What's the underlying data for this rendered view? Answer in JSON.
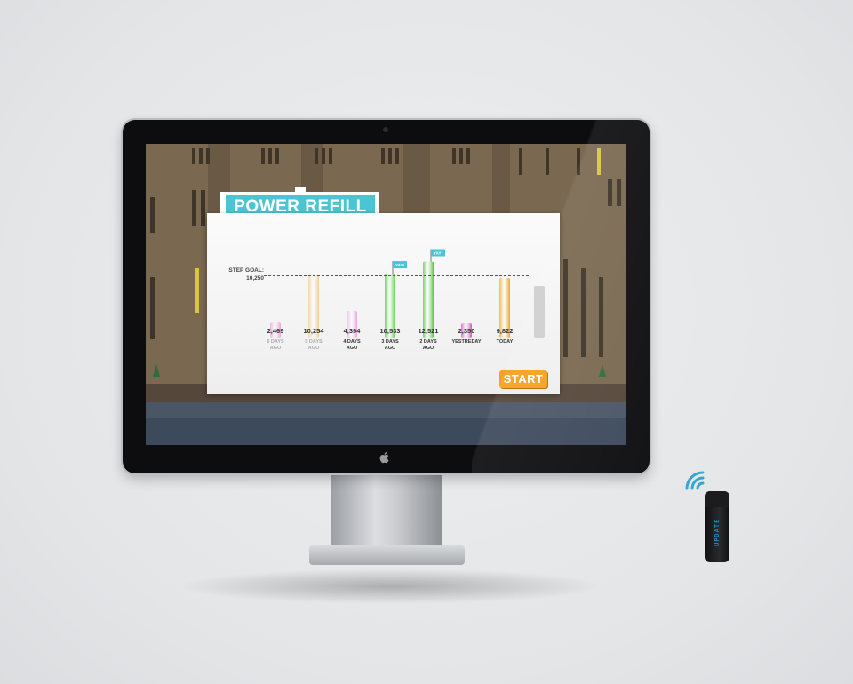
{
  "app": {
    "title": "POWER REFILL",
    "start_label": "START"
  },
  "step_goal": {
    "label": "STEP GOAL:",
    "value": "10,250",
    "numeric": 10250
  },
  "tracker": {
    "display": "UPDATE"
  },
  "chart_data": {
    "type": "bar",
    "categories": [
      "6 DAYS AGO",
      "5 DAYS AGO",
      "4 DAYS AGO",
      "3 DAYS AGO",
      "2 DAYS AGO",
      "YESTREDAY",
      "TODAY"
    ],
    "values": [
      2469,
      10254,
      4394,
      10533,
      12521,
      2350,
      9822
    ],
    "value_labels": [
      "2,469",
      "10,254",
      "4,394",
      "10,533",
      "12,521",
      "2,350",
      "9,822"
    ],
    "bar_colors": [
      "#e3a3d8",
      "#f0cc98",
      "#e7a5e0",
      "#4ec53a",
      "#4ec53a",
      "#d34fb8",
      "#f3a119"
    ],
    "faded": [
      true,
      true,
      false,
      false,
      false,
      false,
      false
    ],
    "flags": [
      null,
      null,
      null,
      "YAY!",
      "YAY!",
      null,
      null
    ],
    "goal": 10250,
    "ylim": [
      0,
      14000
    ]
  }
}
